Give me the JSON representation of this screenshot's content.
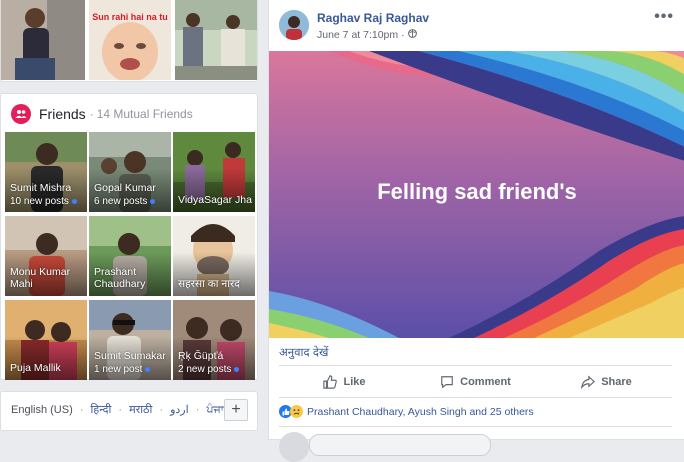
{
  "photos": {
    "meme_caption": "Sun rahi hai na tu"
  },
  "friends": {
    "title": "Friends",
    "subtitle": "14 Mutual Friends",
    "tiles": [
      {
        "name": "Sumit Mishra",
        "posts": "10 new posts"
      },
      {
        "name": "Gopal Kumar",
        "posts": "6 new posts"
      },
      {
        "name": "VidyaSagar Jha",
        "posts": ""
      },
      {
        "name": "Monu Kumar Mahi",
        "posts": ""
      },
      {
        "name": "Prashant Chaudhary",
        "posts": ""
      },
      {
        "name": "सहरसा का नारद",
        "posts": ""
      },
      {
        "name": "Puja Mallik",
        "posts": ""
      },
      {
        "name": "Sumit Sumakar",
        "posts": "1 new post"
      },
      {
        "name": "Ŗķ Ğüpťá",
        "posts": "2 new posts"
      }
    ]
  },
  "languages": {
    "current": "English (US)",
    "options": [
      "हिन्दी",
      "मराठी",
      "اردو",
      "ਪੰਜਾਬੀ"
    ],
    "add_label": "+"
  },
  "post": {
    "author": "Raghav Raj Raghav",
    "timestamp": "June 7 at 7:10pm",
    "more_label": "•••",
    "text": "Felling sad friend's",
    "translate_label": "अनुवाद देखें",
    "actions": {
      "like": "Like",
      "comment": "Comment",
      "share": "Share"
    },
    "reactions_text": "Prashant Chaudhary, Ayush Singh and 25 others",
    "colors": {
      "link": "#385898",
      "banner_top": "#d9779c",
      "banner_bottom": "#5b4fa8"
    }
  }
}
